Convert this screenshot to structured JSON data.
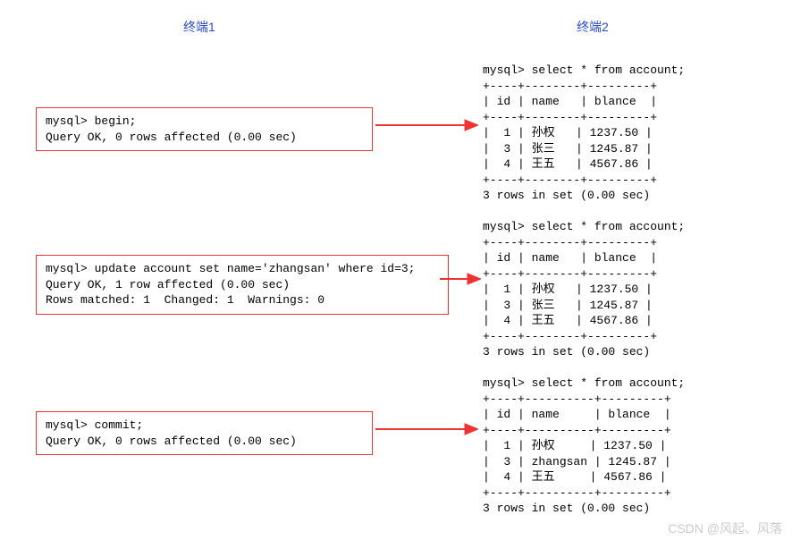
{
  "headers": {
    "left": "终端1",
    "right": "终端2"
  },
  "blocks": {
    "begin": "mysql> begin;\nQuery OK, 0 rows affected (0.00 sec)",
    "update": "mysql> update account set name='zhangsan' where id=3;\nQuery OK, 1 row affected (0.00 sec)\nRows matched: 1  Changed: 1  Warnings: 0",
    "commit": "mysql> commit;\nQuery OK, 0 rows affected (0.00 sec)"
  },
  "outputs": {
    "q1": "mysql> select * from account;\n+----+--------+---------+\n| id | name   | blance  |\n+----+--------+---------+\n|  1 | 孙权   | 1237.50 |\n|  3 | 张三   | 1245.87 |\n|  4 | 王五   | 4567.86 |\n+----+--------+---------+\n3 rows in set (0.00 sec)",
    "q2": "mysql> select * from account;\n+----+--------+---------+\n| id | name   | blance  |\n+----+--------+---------+\n|  1 | 孙权   | 1237.50 |\n|  3 | 张三   | 1245.87 |\n|  4 | 王五   | 4567.86 |\n+----+--------+---------+\n3 rows in set (0.00 sec)",
    "q3": "mysql> select * from account;\n+----+----------+---------+\n| id | name     | blance  |\n+----+----------+---------+\n|  1 | 孙权     | 1237.50 |\n|  3 | zhangsan | 1245.87 |\n|  4 | 王五     | 4567.86 |\n+----+----------+---------+\n3 rows in set (0.00 sec)"
  },
  "watermark": "CSDN @风起、风落"
}
